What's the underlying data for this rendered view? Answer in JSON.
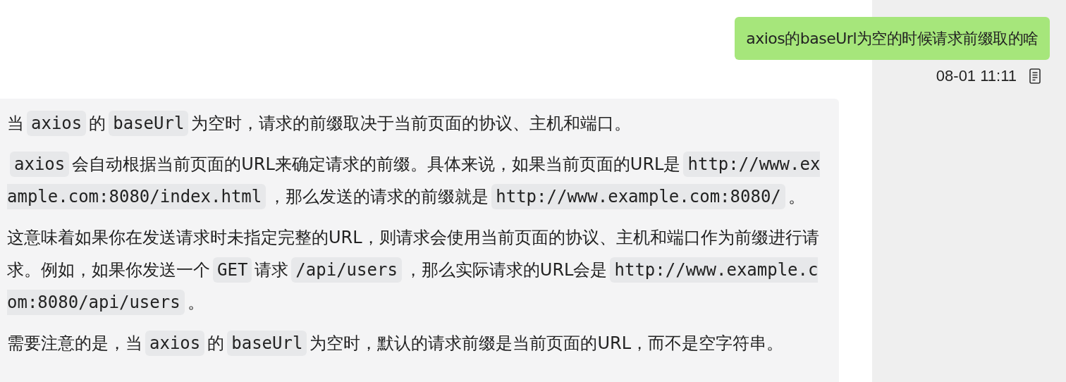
{
  "question": {
    "text": "axios的baseUrl为空的时候请求前缀取的啥",
    "time": "08-01 11:11"
  },
  "answer": {
    "paragraphs": [
      [
        {
          "kind": "text",
          "text": "当"
        },
        {
          "kind": "code",
          "text": "axios"
        },
        {
          "kind": "text",
          "text": "的"
        },
        {
          "kind": "code",
          "text": "baseUrl"
        },
        {
          "kind": "text",
          "text": "为空时，请求的前缀取决于当前页面的协议、主机和端口。"
        }
      ],
      [
        {
          "kind": "code",
          "text": "axios"
        },
        {
          "kind": "text",
          "text": "会自动根据当前页面的URL来确定请求的前缀。具体来说，如果当前页面的URL是"
        },
        {
          "kind": "code",
          "text": "http://www.example.com:8080/index.html"
        },
        {
          "kind": "text",
          "text": "，那么发送的请求的前缀就是"
        },
        {
          "kind": "code",
          "text": "http://www.example.com:8080/"
        },
        {
          "kind": "text",
          "text": "。"
        }
      ],
      [
        {
          "kind": "text",
          "text": "这意味着如果你在发送请求时未指定完整的URL，则请求会使用当前页面的协议、主机和端口作为前缀进行请求。例如，如果你发送一个"
        },
        {
          "kind": "code",
          "text": "GET"
        },
        {
          "kind": "text",
          "text": "请求"
        },
        {
          "kind": "code",
          "text": "/api/users"
        },
        {
          "kind": "text",
          "text": "，那么实际请求的URL会是"
        },
        {
          "kind": "code",
          "text": "http://www.example.com:8080/api/users"
        },
        {
          "kind": "text",
          "text": "。"
        }
      ],
      [
        {
          "kind": "text",
          "text": "需要注意的是，当"
        },
        {
          "kind": "code",
          "text": "axios"
        },
        {
          "kind": "text",
          "text": "的"
        },
        {
          "kind": "code",
          "text": "baseUrl"
        },
        {
          "kind": "text",
          "text": "为空时，默认的请求前缀是当前页面的URL，而不是空字符串。"
        }
      ]
    ]
  }
}
